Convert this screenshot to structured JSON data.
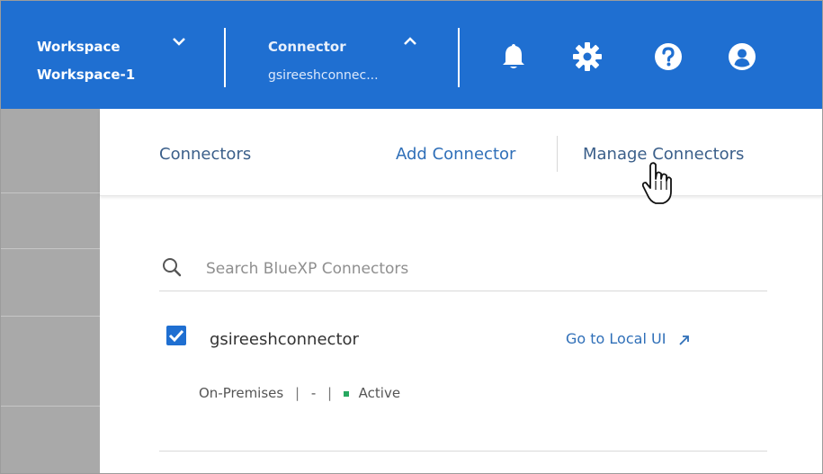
{
  "header": {
    "workspace": {
      "label": "Workspace",
      "value": "Workspace-1"
    },
    "connector": {
      "label": "Connector",
      "value": "gsireeshconnec..."
    },
    "icons": [
      "bell-icon",
      "gear-icon",
      "help-icon",
      "user-icon"
    ]
  },
  "tabs": {
    "connectors": "Connectors",
    "add": "Add Connector",
    "manage": "Manage Connectors"
  },
  "search": {
    "placeholder": "Search BlueXP Connectors",
    "value": ""
  },
  "connector_item": {
    "checked": true,
    "name": "gsireeshconnector",
    "link": "Go to Local UI",
    "location": "On-Premises",
    "sep": "|",
    "dash": "-",
    "status": "Active"
  },
  "colors": {
    "header_bg": "#1f6fd1",
    "accent": "#2f6fb8",
    "checkbox": "#1f6fd1",
    "status_active": "#27a860",
    "sidebar": "#a9a9a9"
  }
}
